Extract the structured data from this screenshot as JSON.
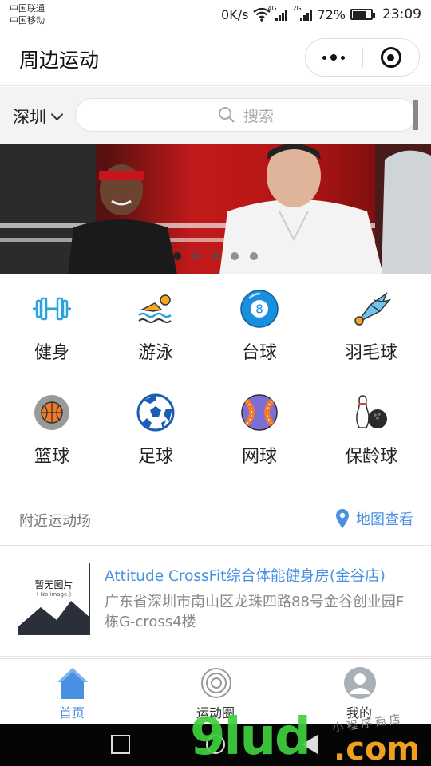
{
  "status_bar": {
    "carrier_1": "中国联通",
    "carrier_2": "中国移动",
    "speed": "0K/s",
    "net_1": "4G",
    "net_2": "2G",
    "battery_text": "72%",
    "battery_level": 0.72,
    "time": "23:09"
  },
  "nav": {
    "title": "周边运动",
    "more_icon": "more-dots-icon",
    "close_icon": "target-icon"
  },
  "search": {
    "city": "深圳",
    "placeholder": "搜索"
  },
  "banner": {
    "slide_count": 5,
    "active_index": 0
  },
  "categories": [
    {
      "label": "健身",
      "icon": "dumbbell-icon"
    },
    {
      "label": "游泳",
      "icon": "swimmer-icon"
    },
    {
      "label": "台球",
      "icon": "billiard-ball-icon"
    },
    {
      "label": "羽毛球",
      "icon": "shuttlecock-icon"
    },
    {
      "label": "篮球",
      "icon": "basketball-icon"
    },
    {
      "label": "足球",
      "icon": "soccer-ball-icon"
    },
    {
      "label": "网球",
      "icon": "baseball-icon"
    },
    {
      "label": "保龄球",
      "icon": "bowling-icon"
    }
  ],
  "nearby": {
    "title": "附近运动场",
    "map_link": "地图查看",
    "venues": [
      {
        "name": "Attitude CrossFit综合体能健身房(金谷店)",
        "address": "广东省深圳市南山区龙珠四路88号金谷创业园F栋G-cross4楼",
        "thumb_text": "暂无图片",
        "thumb_sub": "( No image )"
      }
    ]
  },
  "tabs": [
    {
      "label": "首页",
      "icon": "home-icon",
      "active": true
    },
    {
      "label": "运动圈",
      "icon": "circle-ring-icon",
      "active": false
    },
    {
      "label": "我的",
      "icon": "user-avatar-icon",
      "active": false
    }
  ],
  "watermark": {
    "main": "9lud",
    "suffix": ".com",
    "small": "小程序商店"
  },
  "colors": {
    "accent": "#4a90e2",
    "search_bg": "#f3f3f5"
  }
}
